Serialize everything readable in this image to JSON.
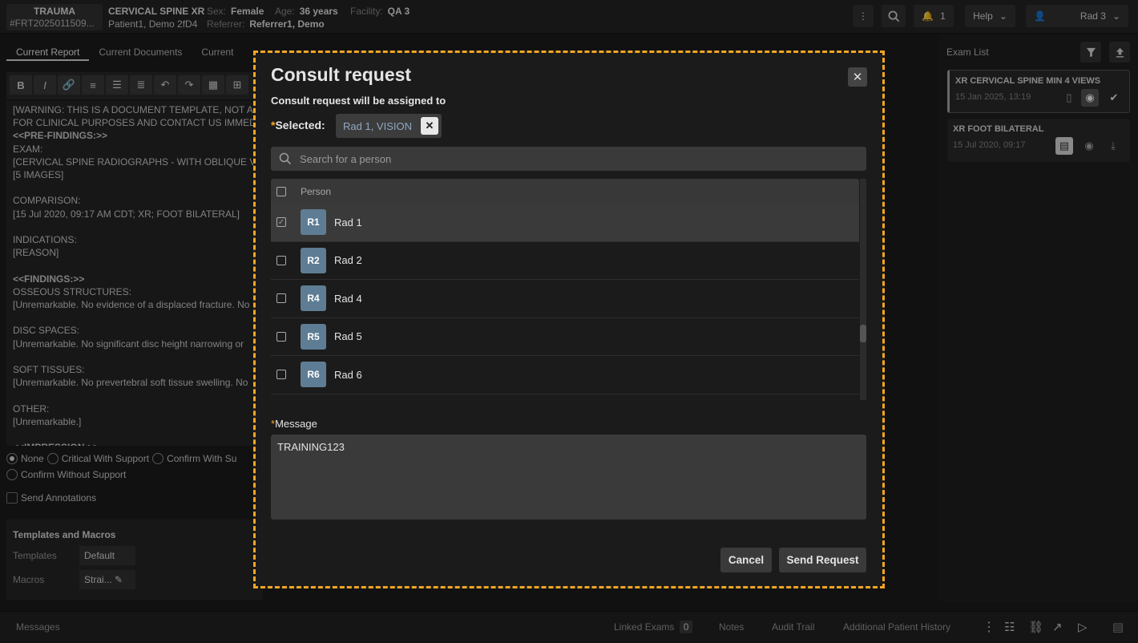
{
  "header": {
    "priority": "TRAUMA",
    "accession": "#FRT2025011509...",
    "exam_title": "CERVICAL SPINE XR",
    "patient": "Patient1, Demo 2fD4",
    "sex_label": "Sex:",
    "sex_value": "Female",
    "age_label": "Age:",
    "age_value": "36 years",
    "facility_label": "Facility:",
    "facility_value": "QA 3",
    "referrer_label": "Referrer:",
    "referrer_value": "Referrer1, Demo",
    "notification_count": "1",
    "help_label": "Help",
    "user_label": "Rad 3"
  },
  "tabs": [
    "Current Report",
    "Current Documents",
    "Current"
  ],
  "report_lines": [
    "[WARNING: THIS IS A DOCUMENT TEMPLATE, NOT A C",
    "FOR CLINICAL PURPOSES AND CONTACT US IMMEDIA",
    "<<PRE-FINDINGS:>>",
    "EXAM:",
    "[CERVICAL SPINE RADIOGRAPHS - WITH OBLIQUE VIEW",
    "[5 IMAGES]",
    "",
    "COMPARISON:",
    "[15 Jul 2020, 09:17 AM CDT; XR; FOOT BILATERAL]",
    "",
    "INDICATIONS:",
    "[REASON]",
    "",
    "<<FINDINGS:>>",
    "OSSEOUS STRUCTURES:",
    "[Unremarkable. No evidence of a displaced fracture. No",
    "",
    "DISC SPACES:",
    "[Unremarkable. No significant disc height narrowing or",
    "",
    "SOFT TISSUES:",
    "[Unremarkable. No prevertebral soft tissue swelling. No",
    "",
    "OTHER:",
    "[Unremarkable.]",
    "",
    "<<IMPRESSION:>>"
  ],
  "support_options": [
    "None",
    "Critical With Support",
    "Confirm With Su",
    "Confirm Without Support"
  ],
  "send_annotations": "Send Annotations",
  "templates": {
    "title": "Templates and Macros",
    "templates_label": "Templates",
    "templates_value": "Default",
    "macros_label": "Macros",
    "macros_value": "Strai..."
  },
  "exam_list": {
    "title": "Exam List",
    "items": [
      {
        "name": "XR CERVICAL SPINE MIN 4 VIEWS",
        "date": "15 Jan 2025, 13:19"
      },
      {
        "name": "XR FOOT BILATERAL",
        "date": "15 Jul 2020, 09:17"
      }
    ]
  },
  "bottom": {
    "messages": "Messages",
    "linked_exams": "Linked Exams",
    "linked_count": "0",
    "notes": "Notes",
    "audit": "Audit Trail",
    "history": "Additional Patient History"
  },
  "modal": {
    "title": "Consult request",
    "subtitle": "Consult request will be assigned to",
    "selected_label": "Selected:",
    "selected_chip": "Rad 1, VISION",
    "search_placeholder": "Search for a person",
    "column_person": "Person",
    "people": [
      {
        "initials": "R1",
        "name": "Rad 1",
        "checked": true
      },
      {
        "initials": "R2",
        "name": "Rad 2",
        "checked": false
      },
      {
        "initials": "R4",
        "name": "Rad 4",
        "checked": false
      },
      {
        "initials": "R5",
        "name": "Rad 5",
        "checked": false
      },
      {
        "initials": "R6",
        "name": "Rad 6",
        "checked": false
      }
    ],
    "message_label": "Message",
    "message_value": "TRAINING123",
    "cancel_label": "Cancel",
    "send_label": "Send Request"
  },
  "colors": {
    "accent_border": "#f5a623",
    "avatar": "#5e7d94"
  }
}
